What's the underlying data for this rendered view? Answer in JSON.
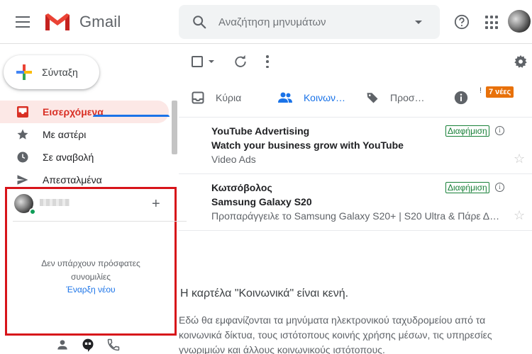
{
  "app": {
    "name": "Gmail"
  },
  "search": {
    "placeholder": "Αναζήτηση μηνυμάτων"
  },
  "compose": {
    "label": "Σύνταξη"
  },
  "sidebar": {
    "items": [
      {
        "label": "Εισερχόμενα",
        "icon": "inbox-icon",
        "active": true
      },
      {
        "label": "Με αστέρι",
        "icon": "star-icon"
      },
      {
        "label": "Σε αναβολή",
        "icon": "clock-icon"
      },
      {
        "label": "Απεσταλμένα",
        "icon": "send-icon"
      }
    ]
  },
  "hangouts": {
    "empty_line1": "Δεν υπάρχουν πρόσφατες",
    "empty_line2": "συνομιλίες",
    "start_new": "Έναρξη νέου",
    "add": "+"
  },
  "tabs": [
    {
      "label": "Κύρια",
      "icon": "inbox-tab-icon"
    },
    {
      "label": "Κοινων…",
      "icon": "people-icon",
      "active": true
    },
    {
      "label": "Προσ…",
      "icon": "tag-icon"
    },
    {
      "label": "",
      "icon": "info-icon"
    }
  ],
  "new_badge": {
    "mark": "!",
    "text": "7 νέες"
  },
  "emails": [
    {
      "sender": "YouTube Advertising",
      "subject": "Watch your business grow with YouTube",
      "snippet": "Video Ads",
      "badge": "Διαφήμιση"
    },
    {
      "sender": "Κωτσόβολος",
      "subject": "Samsung Galaxy S20",
      "snippet": "Προπαράγγειλε το Samsung Galaxy S20+ | S20 Ultra & Πάρε Δ…",
      "badge": "Διαφήμιση"
    }
  ],
  "empty_state": {
    "title": "Η καρτέλα \"Κοινωνικά\" είναι κενή.",
    "description": "Εδώ θα εμφανίζονται τα μηνύματα ηλεκτρονικού ταχυδρομείου από τα κοινωνικά δίκτυα, τους ιστότοπους κοινής χρήσης μέσων, τις υπηρεσίες γνωριμιών και άλλους κοινωνικούς ιστότοπους."
  },
  "colors": {
    "accent": "#1a73e8",
    "inbox_red": "#d93025",
    "badge_orange": "#e8710a",
    "promo_green": "#188038",
    "highlight_box": "#d7141a"
  }
}
